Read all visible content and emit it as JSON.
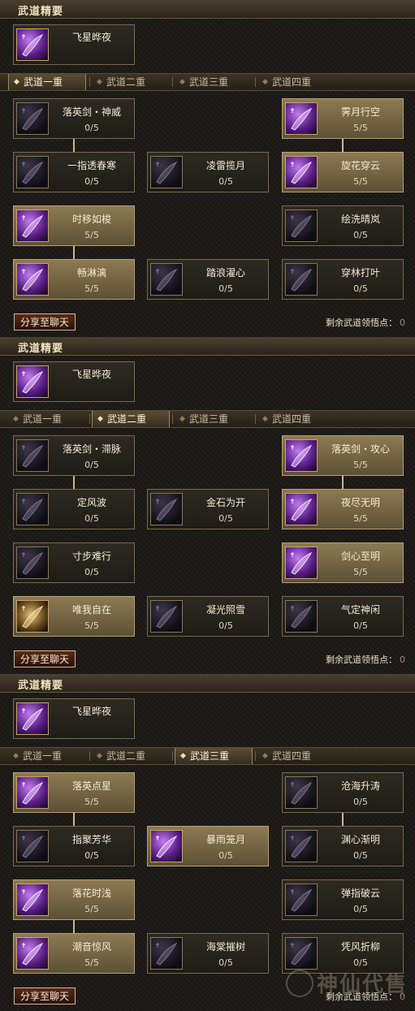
{
  "sections": [
    {
      "title": "武道精要",
      "essence": {
        "name": "飞星晔夜",
        "icon": "star-night-skill-icon"
      },
      "tabs": [
        "武道一重",
        "武道二重",
        "武道三重",
        "武道四重"
      ],
      "active_tab": 0,
      "skills": [
        {
          "name": "落英剑・神威",
          "value": "0/5",
          "icon": "sword-skill-icon",
          "state": "inactive"
        },
        {
          "name": "一指透春寒",
          "value": "0/5",
          "icon": "finger-skill-icon",
          "state": "inactive"
        },
        {
          "name": "凌雷揽月",
          "value": "0/5",
          "icon": "thunder-moon-icon",
          "state": "inactive"
        },
        {
          "name": "时移如梭",
          "value": "5/5",
          "icon": "time-shift-icon",
          "state": "learned"
        },
        {
          "name": "畅淋漓",
          "value": "5/5",
          "icon": "flow-skill-icon",
          "state": "learned"
        },
        {
          "name": "踏浪濯心",
          "value": "0/5",
          "icon": "wave-skill-icon",
          "state": "inactive"
        },
        {
          "name": "霁月行空",
          "value": "5/5",
          "icon": "moon-walk-icon",
          "state": "learned"
        },
        {
          "name": "旋花穿云",
          "value": "5/5",
          "icon": "flower-cloud-icon",
          "state": "learned"
        },
        {
          "name": "绘洗晴岚",
          "value": "0/5",
          "icon": "mist-skill-icon",
          "state": "inactive"
        },
        {
          "name": "穿林打叶",
          "value": "0/5",
          "icon": "leaf-skill-icon",
          "state": "inactive"
        }
      ],
      "share_label": "分享至聊天",
      "remaining_label": "剩余武道领悟点：",
      "remaining_points": "0"
    },
    {
      "title": "武道精要",
      "essence": {
        "name": "飞星晔夜",
        "icon": "star-night-skill-icon"
      },
      "tabs": [
        "武道一重",
        "武道二重",
        "武道三重",
        "武道四重"
      ],
      "active_tab": 1,
      "skills": [
        {
          "name": "落英剑・滞脉",
          "value": "0/5",
          "icon": "sword-skill-icon",
          "state": "inactive"
        },
        {
          "name": "定风波",
          "value": "0/5",
          "icon": "wind-skill-icon",
          "state": "inactive"
        },
        {
          "name": "寸步难行",
          "value": "0/5",
          "icon": "step-skill-icon",
          "state": "inactive"
        },
        {
          "name": "唯我自在",
          "value": "5/5",
          "icon": "self-skill-icon",
          "state": "gold"
        },
        {
          "name": "金石为开",
          "value": "0/5",
          "icon": "stone-skill-icon",
          "state": "inactive"
        },
        {
          "name": "凝光照雪",
          "value": "0/5",
          "icon": "snow-light-icon",
          "state": "inactive"
        },
        {
          "name": "落英剑・攻心",
          "value": "5/5",
          "icon": "sword-heart-icon",
          "state": "learned"
        },
        {
          "name": "夜尽无明",
          "value": "5/5",
          "icon": "night-end-icon",
          "state": "learned"
        },
        {
          "name": "剑心至明",
          "value": "5/5",
          "icon": "sword-mind-icon",
          "state": "learned"
        },
        {
          "name": "气定神闲",
          "value": "0/5",
          "icon": "calm-mind-icon",
          "state": "inactive"
        }
      ],
      "share_label": "分享至聊天",
      "remaining_label": "剩余武道领悟点：",
      "remaining_points": "0"
    },
    {
      "title": "武道精要",
      "essence": {
        "name": "飞星晔夜",
        "icon": "star-night-skill-icon"
      },
      "tabs": [
        "武道一重",
        "武道二重",
        "武道三重",
        "武道四重"
      ],
      "active_tab": 2,
      "skills": [
        {
          "name": "落英点星",
          "value": "5/5",
          "icon": "star-point-icon",
          "state": "learned"
        },
        {
          "name": "指聚芳华",
          "value": "0/5",
          "icon": "finger-bloom-icon",
          "state": "inactive"
        },
        {
          "name": "落花时浅",
          "value": "5/5",
          "icon": "falling-flower-icon",
          "state": "learned"
        },
        {
          "name": "潮音惊风",
          "value": "5/5",
          "icon": "tide-wind-icon",
          "state": "learned"
        },
        {
          "name": "暴雨笼月",
          "value": "0/5",
          "icon": "storm-moon-icon",
          "state": "highlight"
        },
        {
          "name": "海棠摧树",
          "value": "0/5",
          "icon": "crabapple-icon",
          "state": "inactive"
        },
        {
          "name": "沧海升涛",
          "value": "0/5",
          "icon": "sea-wave-icon",
          "state": "inactive"
        },
        {
          "name": "渊心渐明",
          "value": "0/5",
          "icon": "abyss-mind-icon",
          "state": "inactive"
        },
        {
          "name": "弹指破云",
          "value": "0/5",
          "icon": "flick-cloud-icon",
          "state": "inactive"
        },
        {
          "name": "凭风折柳",
          "value": "0/5",
          "icon": "wind-willow-icon",
          "state": "inactive"
        }
      ],
      "share_label": "分享至聊天",
      "remaining_label": "剩余武道领悟点：",
      "remaining_points": "0"
    }
  ],
  "watermark": "神仙代售"
}
